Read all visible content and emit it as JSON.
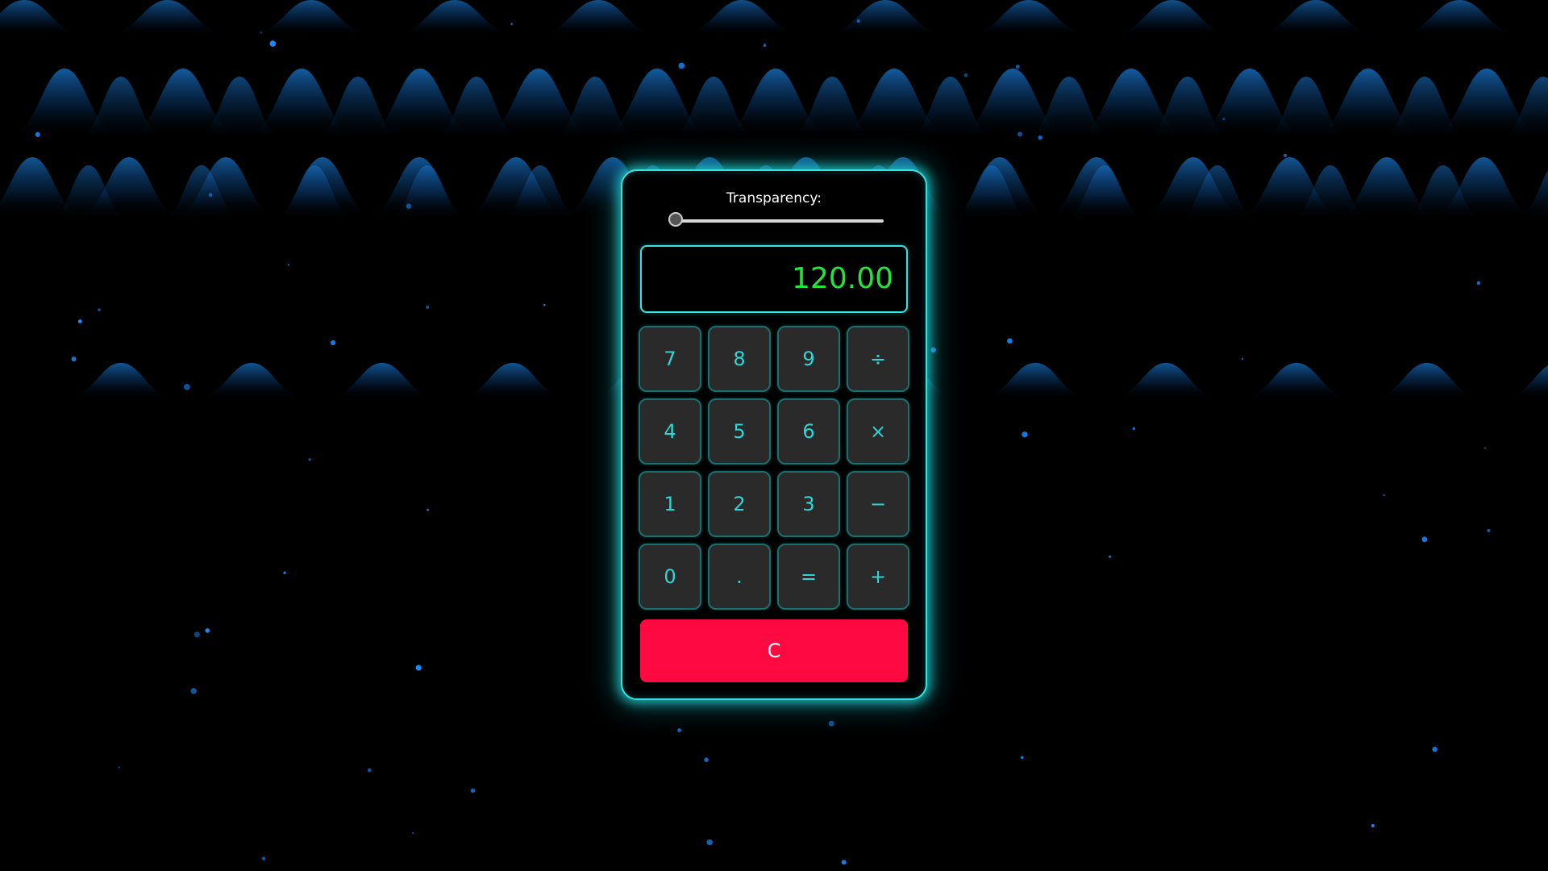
{
  "calculator": {
    "transparency_label": "Transparency:",
    "transparency_value": 0,
    "display_value": "120.00",
    "keys": [
      "7",
      "8",
      "9",
      "÷",
      "4",
      "5",
      "6",
      "×",
      "1",
      "2",
      "3",
      "−",
      "0",
      ".",
      "=",
      "+"
    ],
    "clear_label": "C"
  },
  "colors": {
    "accent": "#35e3e3",
    "display_text": "#22e53a",
    "key_text": "#31d5d5",
    "key_background": "#2a2a2a",
    "clear_button": "#ff0a40",
    "background": "#000000",
    "wave": "#1a6fc0",
    "particle": "#1a8cff"
  }
}
